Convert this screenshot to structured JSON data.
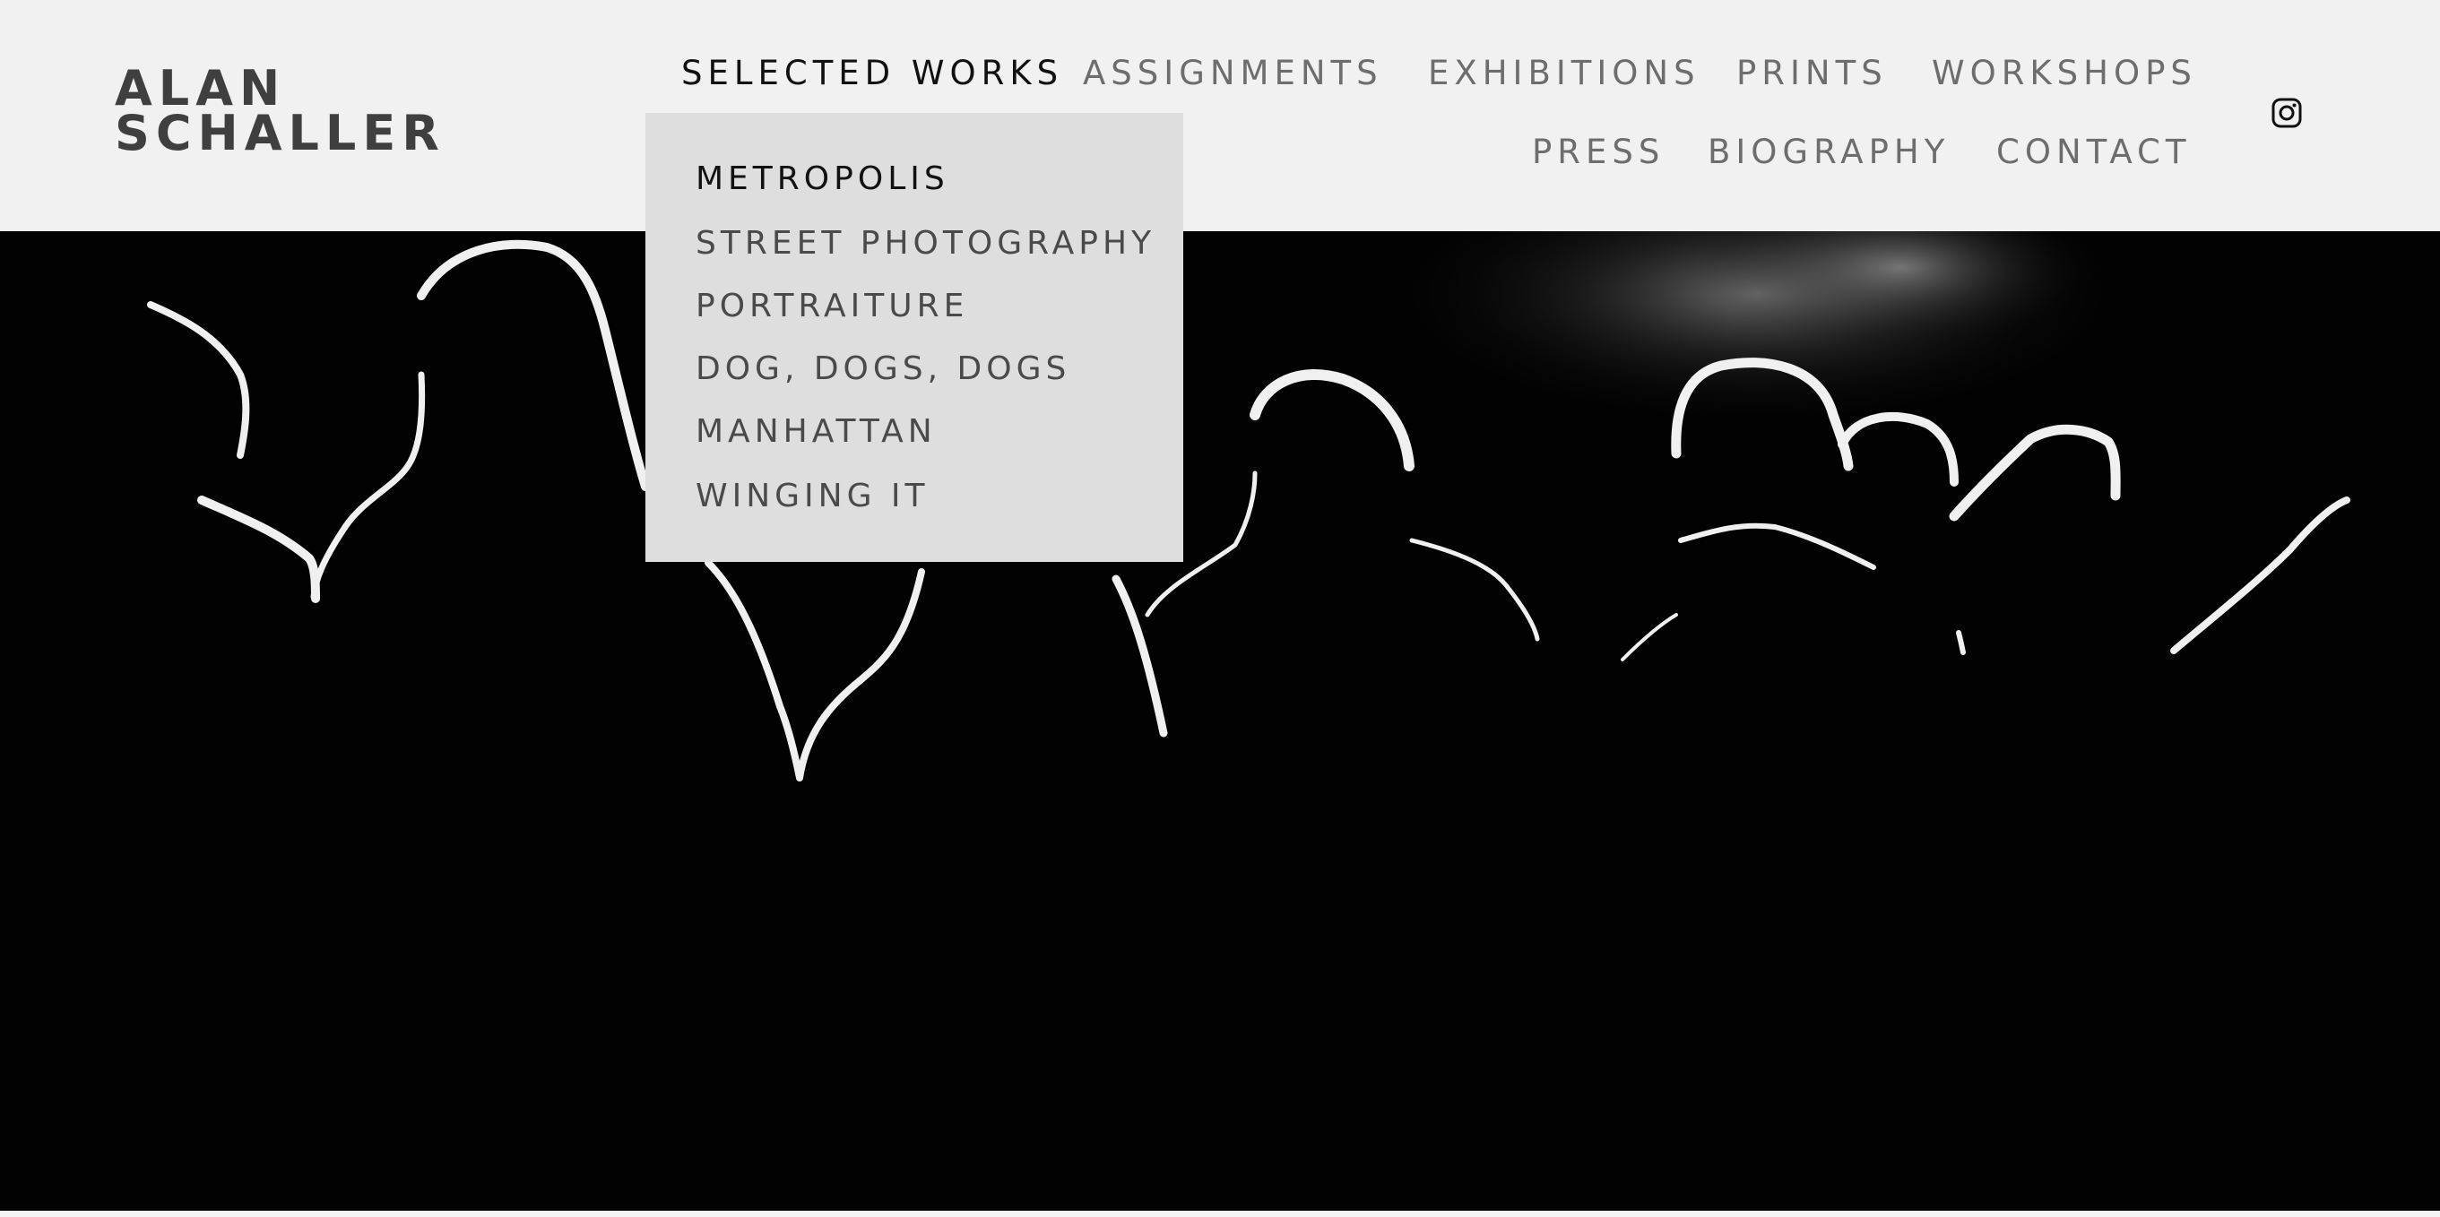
{
  "logo": {
    "line1": "ALAN",
    "line2": "SCHALLER"
  },
  "nav": {
    "row1": [
      "SELECTED WORKS",
      "ASSIGNMENTS",
      "EXHIBITIONS",
      "PRINTS",
      "WORKSHOPS"
    ],
    "row2": [
      "PRESS",
      "BIOGRAPHY",
      "CONTACT"
    ],
    "active": "SELECTED WORKS"
  },
  "dropdown": {
    "items": [
      "METROPOLIS",
      "STREET PHOTOGRAPHY",
      "PORTRAITURE",
      "DOG, DOGS, DOGS",
      "MANHATTAN",
      "WINGING IT"
    ],
    "current": "METROPOLIS"
  },
  "social": {
    "icon": "instagram-icon"
  },
  "hero": {
    "description_icon": "photo",
    "colors": {
      "background": "#020202",
      "rim_light": "#f2f2f2"
    }
  },
  "colors": {
    "header_bg": "#f1f1f1",
    "dropdown_bg": "#dedede",
    "nav_text": "#6d6d6d",
    "active_text": "#111111",
    "logo_text": "#3f3f3f"
  }
}
